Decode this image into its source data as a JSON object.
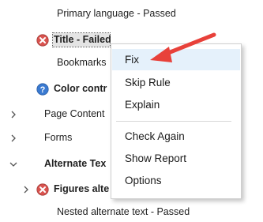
{
  "tree": {
    "primary_language": "Primary language - Passed",
    "title": "Title - Failed",
    "bookmarks": "Bookmarks",
    "color_contrast": "Color contr",
    "page_content": "Page Content",
    "forms": "Forms",
    "alternate_text": "Alternate Tex",
    "figures_alt": "Figures alte",
    "nested_alt": "Nested alternate text - Passed"
  },
  "context_menu": {
    "items": [
      "Fix",
      "Skip Rule",
      "Explain",
      "Check Again",
      "Show Report",
      "Options"
    ],
    "highlighted": "Fix"
  },
  "icons": {
    "failed": "failed-icon",
    "needs_check": "question-icon",
    "collapsed": "chevron-right-icon",
    "expanded": "chevron-down-icon"
  },
  "colors": {
    "failed_red": "#c94a4a",
    "question_blue": "#3a7ad1",
    "menu_hover": "#e5f1fb",
    "arrow_red": "#e8413a"
  }
}
